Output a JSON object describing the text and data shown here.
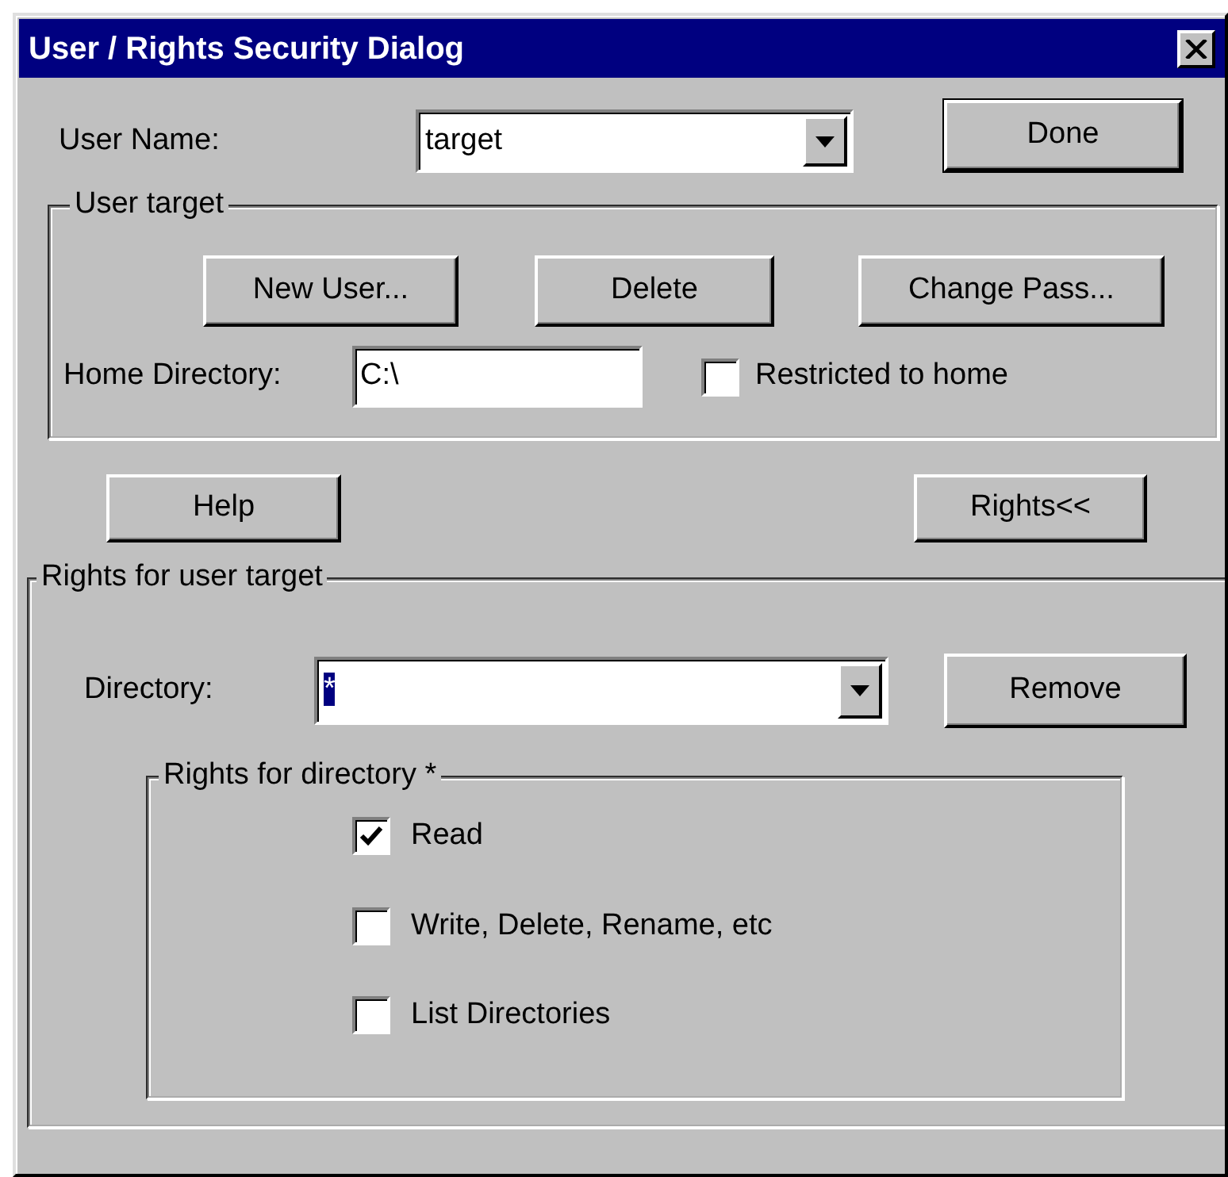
{
  "window": {
    "title": "User / Rights Security Dialog"
  },
  "user_name": {
    "label": "User Name:",
    "value": "target"
  },
  "done_button": "Done",
  "user_group": {
    "title": "User target",
    "buttons": [
      "New User...",
      "Delete",
      "Change Pass..."
    ],
    "home_directory": {
      "label": "Home Directory:",
      "value": "C:\\"
    },
    "restricted": {
      "label": "Restricted to home",
      "checked": false
    }
  },
  "buttons": [
    "Help",
    "Rights<<"
  ],
  "rights_group": {
    "title": "Rights for user target",
    "directory": {
      "label": "Directory:",
      "value": "*",
      "selected": true
    },
    "remove_button": "Remove",
    "directory_rights": {
      "title": "Rights for directory *",
      "options": [
        {
          "label": "Read",
          "checked": true
        },
        {
          "label": "Write, Delete, Rename, etc",
          "checked": false
        },
        {
          "label": "List Directories",
          "checked": false
        }
      ]
    }
  }
}
